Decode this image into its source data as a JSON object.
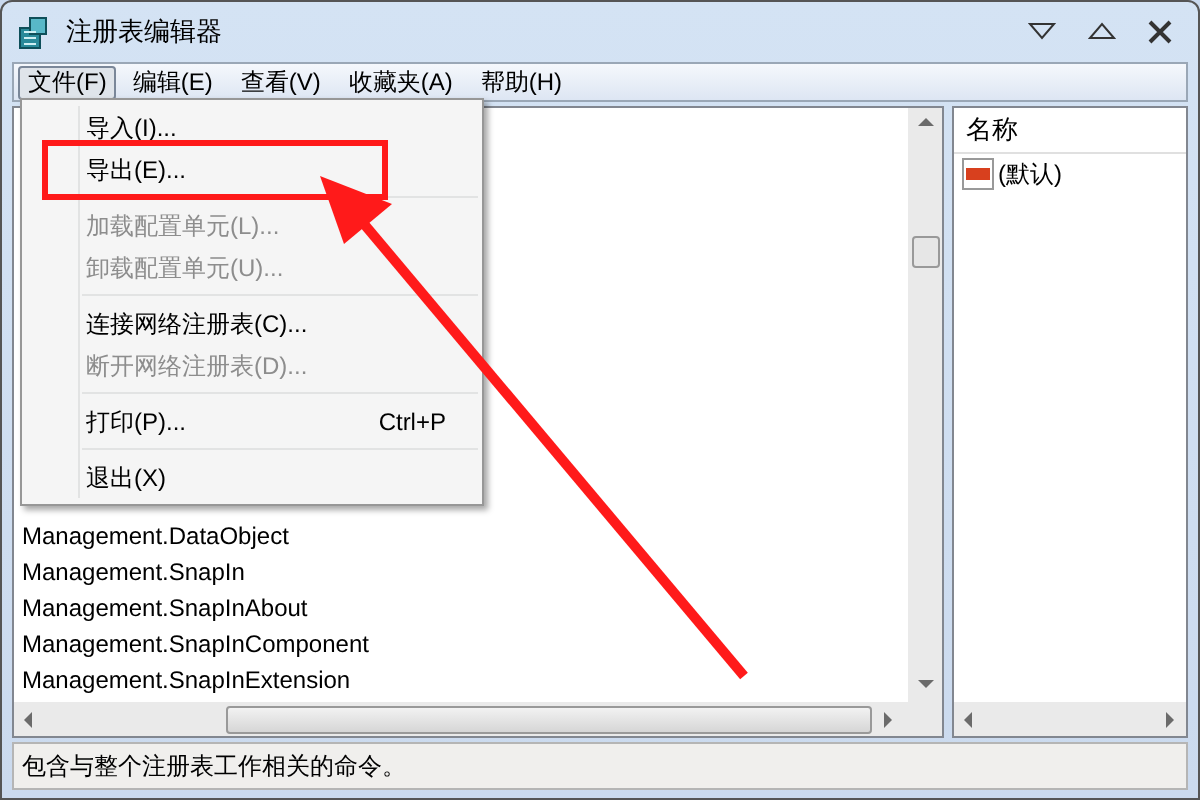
{
  "window": {
    "title": "注册表编辑器"
  },
  "menu_bar": [
    {
      "label": "文件(F)",
      "selected": true
    },
    {
      "label": "编辑(E)",
      "selected": false
    },
    {
      "label": "查看(V)",
      "selected": false
    },
    {
      "label": "收藏夹(A)",
      "selected": false
    },
    {
      "label": "帮助(H)",
      "selected": false
    }
  ],
  "file_menu": {
    "items": [
      {
        "kind": "item",
        "label": "导入(I)...",
        "disabled": false,
        "annotated": false
      },
      {
        "kind": "item",
        "label": "导出(E)...",
        "disabled": false,
        "annotated": true
      },
      {
        "kind": "separator"
      },
      {
        "kind": "item",
        "label": "加载配置单元(L)...",
        "disabled": true,
        "annotated": false
      },
      {
        "kind": "item",
        "label": "卸载配置单元(U)...",
        "disabled": true,
        "annotated": false
      },
      {
        "kind": "separator"
      },
      {
        "kind": "item",
        "label": "连接网络注册表(C)...",
        "disabled": false,
        "annotated": false
      },
      {
        "kind": "item",
        "label": "断开网络注册表(D)...",
        "disabled": true,
        "annotated": false
      },
      {
        "kind": "separator"
      },
      {
        "kind": "item",
        "label": "打印(P)...",
        "shortcut": "Ctrl+P",
        "disabled": false,
        "annotated": false
      },
      {
        "kind": "separator"
      },
      {
        "kind": "item",
        "label": "退出(X)",
        "disabled": false,
        "annotated": false
      }
    ]
  },
  "tree": {
    "rows": [
      "Management.DataObject",
      "Management.SnapIn",
      "Management.SnapInAbout",
      "Management.SnapInComponent",
      "Management.SnapInExtension"
    ]
  },
  "values_pane": {
    "columns": [
      "名称"
    ],
    "rows": [
      {
        "name": "(默认)"
      }
    ]
  },
  "status_bar": "包含与整个注册表工作相关的命令。"
}
